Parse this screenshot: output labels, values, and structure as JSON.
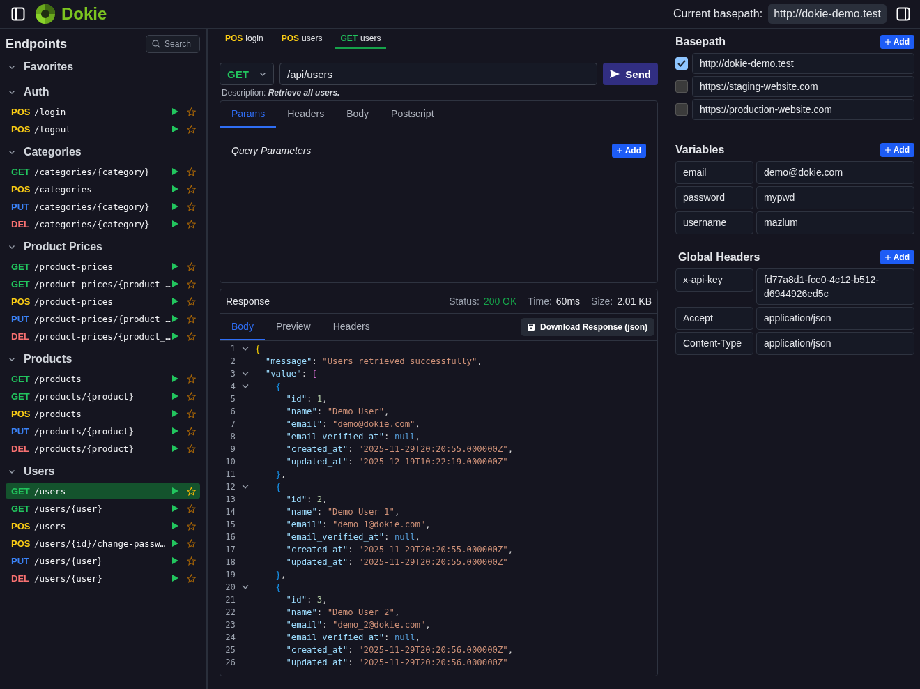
{
  "header": {
    "title": "Dokie",
    "basepath_label": "Current basepath:",
    "basepath": "http://dokie-demo.test"
  },
  "sidebar": {
    "title": "Endpoints",
    "search_placeholder": "Search",
    "groups": [
      {
        "name": "Favorites",
        "expanded": true
      },
      {
        "name": "Auth",
        "expanded": true,
        "endpoints": [
          {
            "method": "POS",
            "color": "#facc15",
            "path": "/login",
            "selected": false
          },
          {
            "method": "POS",
            "color": "#facc15",
            "path": "/logout",
            "selected": false
          }
        ]
      },
      {
        "name": "Categories",
        "expanded": true,
        "endpoints": [
          {
            "method": "GET",
            "color": "#22c55e",
            "path": "/categories/{category}",
            "selected": false
          },
          {
            "method": "POS",
            "color": "#facc15",
            "path": "/categories",
            "selected": false
          },
          {
            "method": "PUT",
            "color": "#3b82f6",
            "path": "/categories/{category}",
            "selected": false
          },
          {
            "method": "DEL",
            "color": "#f87171",
            "path": "/categories/{category}",
            "selected": false
          }
        ]
      },
      {
        "name": "Product Prices",
        "expanded": true,
        "endpoints": [
          {
            "method": "GET",
            "color": "#22c55e",
            "path": "/product-prices",
            "selected": false
          },
          {
            "method": "GET",
            "color": "#22c55e",
            "path": "/product-prices/{product_…",
            "selected": false
          },
          {
            "method": "POS",
            "color": "#facc15",
            "path": "/product-prices",
            "selected": false
          },
          {
            "method": "PUT",
            "color": "#3b82f6",
            "path": "/product-prices/{product_…",
            "selected": false
          },
          {
            "method": "DEL",
            "color": "#f87171",
            "path": "/product-prices/{product_…",
            "selected": false
          }
        ]
      },
      {
        "name": "Products",
        "expanded": true,
        "endpoints": [
          {
            "method": "GET",
            "color": "#22c55e",
            "path": "/products",
            "selected": false
          },
          {
            "method": "GET",
            "color": "#22c55e",
            "path": "/products/{product}",
            "selected": false
          },
          {
            "method": "POS",
            "color": "#facc15",
            "path": "/products",
            "selected": false
          },
          {
            "method": "PUT",
            "color": "#3b82f6",
            "path": "/products/{product}",
            "selected": false
          },
          {
            "method": "DEL",
            "color": "#f87171",
            "path": "/products/{product}",
            "selected": false
          }
        ]
      },
      {
        "name": "Users",
        "expanded": true,
        "endpoints": [
          {
            "method": "GET",
            "color": "#22c55e",
            "path": "/users",
            "selected": true
          },
          {
            "method": "GET",
            "color": "#22c55e",
            "path": "/users/{user}",
            "selected": false
          },
          {
            "method": "POS",
            "color": "#facc15",
            "path": "/users",
            "selected": false
          },
          {
            "method": "POS",
            "color": "#facc15",
            "path": "/users/{id}/change-passw…",
            "selected": false
          },
          {
            "method": "PUT",
            "color": "#3b82f6",
            "path": "/users/{user}",
            "selected": false
          },
          {
            "method": "DEL",
            "color": "#f87171",
            "path": "/users/{user}",
            "selected": false
          }
        ]
      }
    ]
  },
  "open_tabs": [
    {
      "method": "POS",
      "color": "#facc15",
      "name": "login",
      "selected": false
    },
    {
      "method": "POS",
      "color": "#facc15",
      "name": "users",
      "selected": false
    },
    {
      "method": "GET",
      "color": "#22c55e",
      "name": "users",
      "selected": true
    }
  ],
  "request": {
    "method": {
      "label": "GET",
      "color": "#22c55e"
    },
    "url": "/api/users",
    "send": "Send",
    "description_label": "Description:",
    "description": "Retrieve all users.",
    "tabs": [
      {
        "label": "Params",
        "selected": true
      },
      {
        "label": "Headers",
        "selected": false
      },
      {
        "label": "Body",
        "selected": false
      },
      {
        "label": "Postscript",
        "selected": false
      }
    ],
    "query_title": "Query Parameters",
    "add": "Add"
  },
  "response": {
    "title": "Response",
    "status_label": "Status:",
    "status": "200 OK",
    "time_label": "Time:",
    "time": "60ms",
    "size_label": "Size:",
    "size": "2.01 KB",
    "tabs": [
      {
        "label": "Body",
        "selected": true
      },
      {
        "label": "Preview",
        "selected": false
      },
      {
        "label": "Headers",
        "selected": false
      }
    ],
    "download": "Download Response (json)",
    "lines": [
      {
        "number": "1",
        "foldable": true,
        "tokens": [
          {
            "kind": "brace1",
            "text": "{"
          }
        ]
      },
      {
        "number": "2",
        "foldable": false,
        "tokens": [
          {
            "kind": "key",
            "text": "  \"message\""
          },
          {
            "kind": "p",
            "text": ": "
          },
          {
            "kind": "str",
            "text": "\"Users retrieved successfully\""
          },
          {
            "kind": "p",
            "text": ","
          }
        ]
      },
      {
        "number": "3",
        "foldable": true,
        "tokens": [
          {
            "kind": "key",
            "text": "  \"value\""
          },
          {
            "kind": "p",
            "text": ": "
          },
          {
            "kind": "bracket",
            "text": "["
          }
        ]
      },
      {
        "number": "4",
        "foldable": true,
        "tokens": [
          {
            "kind": "brace2",
            "text": "    {"
          }
        ]
      },
      {
        "number": "5",
        "foldable": false,
        "tokens": [
          {
            "kind": "key",
            "text": "      \"id\""
          },
          {
            "kind": "p",
            "text": ": "
          },
          {
            "kind": "num",
            "text": "1"
          },
          {
            "kind": "p",
            "text": ","
          }
        ]
      },
      {
        "number": "6",
        "foldable": false,
        "tokens": [
          {
            "kind": "key",
            "text": "      \"name\""
          },
          {
            "kind": "p",
            "text": ": "
          },
          {
            "kind": "str",
            "text": "\"Demo User\""
          },
          {
            "kind": "p",
            "text": ","
          }
        ]
      },
      {
        "number": "7",
        "foldable": false,
        "tokens": [
          {
            "kind": "key",
            "text": "      \"email\""
          },
          {
            "kind": "p",
            "text": ": "
          },
          {
            "kind": "str",
            "text": "\"demo@dokie.com\""
          },
          {
            "kind": "p",
            "text": ","
          }
        ]
      },
      {
        "number": "8",
        "foldable": false,
        "tokens": [
          {
            "kind": "key",
            "text": "      \"email_verified_at\""
          },
          {
            "kind": "p",
            "text": ": "
          },
          {
            "kind": "null",
            "text": "null"
          },
          {
            "kind": "p",
            "text": ","
          }
        ]
      },
      {
        "number": "9",
        "foldable": false,
        "tokens": [
          {
            "kind": "key",
            "text": "      \"created_at\""
          },
          {
            "kind": "p",
            "text": ": "
          },
          {
            "kind": "str",
            "text": "\"2025-11-29T20:20:55.000000Z\""
          },
          {
            "kind": "p",
            "text": ","
          }
        ]
      },
      {
        "number": "10",
        "foldable": false,
        "tokens": [
          {
            "kind": "key",
            "text": "      \"updated_at\""
          },
          {
            "kind": "p",
            "text": ": "
          },
          {
            "kind": "str",
            "text": "\"2025-12-19T10:22:19.000000Z\""
          }
        ]
      },
      {
        "number": "11",
        "foldable": false,
        "tokens": [
          {
            "kind": "brace2",
            "text": "    }"
          },
          {
            "kind": "p",
            "text": ","
          }
        ]
      },
      {
        "number": "12",
        "foldable": true,
        "tokens": [
          {
            "kind": "brace2",
            "text": "    {"
          }
        ]
      },
      {
        "number": "13",
        "foldable": false,
        "tokens": [
          {
            "kind": "key",
            "text": "      \"id\""
          },
          {
            "kind": "p",
            "text": ": "
          },
          {
            "kind": "num",
            "text": "2"
          },
          {
            "kind": "p",
            "text": ","
          }
        ]
      },
      {
        "number": "14",
        "foldable": false,
        "tokens": [
          {
            "kind": "key",
            "text": "      \"name\""
          },
          {
            "kind": "p",
            "text": ": "
          },
          {
            "kind": "str",
            "text": "\"Demo User 1\""
          },
          {
            "kind": "p",
            "text": ","
          }
        ]
      },
      {
        "number": "15",
        "foldable": false,
        "tokens": [
          {
            "kind": "key",
            "text": "      \"email\""
          },
          {
            "kind": "p",
            "text": ": "
          },
          {
            "kind": "str",
            "text": "\"demo_1@dokie.com\""
          },
          {
            "kind": "p",
            "text": ","
          }
        ]
      },
      {
        "number": "16",
        "foldable": false,
        "tokens": [
          {
            "kind": "key",
            "text": "      \"email_verified_at\""
          },
          {
            "kind": "p",
            "text": ": "
          },
          {
            "kind": "null",
            "text": "null"
          },
          {
            "kind": "p",
            "text": ","
          }
        ]
      },
      {
        "number": "17",
        "foldable": false,
        "tokens": [
          {
            "kind": "key",
            "text": "      \"created_at\""
          },
          {
            "kind": "p",
            "text": ": "
          },
          {
            "kind": "str",
            "text": "\"2025-11-29T20:20:55.000000Z\""
          },
          {
            "kind": "p",
            "text": ","
          }
        ]
      },
      {
        "number": "18",
        "foldable": false,
        "tokens": [
          {
            "kind": "key",
            "text": "      \"updated_at\""
          },
          {
            "kind": "p",
            "text": ": "
          },
          {
            "kind": "str",
            "text": "\"2025-11-29T20:20:55.000000Z\""
          }
        ]
      },
      {
        "number": "19",
        "foldable": false,
        "tokens": [
          {
            "kind": "brace2",
            "text": "    }"
          },
          {
            "kind": "p",
            "text": ","
          }
        ]
      },
      {
        "number": "20",
        "foldable": true,
        "tokens": [
          {
            "kind": "brace2",
            "text": "    {"
          }
        ]
      },
      {
        "number": "21",
        "foldable": false,
        "tokens": [
          {
            "kind": "key",
            "text": "      \"id\""
          },
          {
            "kind": "p",
            "text": ": "
          },
          {
            "kind": "num",
            "text": "3"
          },
          {
            "kind": "p",
            "text": ","
          }
        ]
      },
      {
        "number": "22",
        "foldable": false,
        "tokens": [
          {
            "kind": "key",
            "text": "      \"name\""
          },
          {
            "kind": "p",
            "text": ": "
          },
          {
            "kind": "str",
            "text": "\"Demo User 2\""
          },
          {
            "kind": "p",
            "text": ","
          }
        ]
      },
      {
        "number": "23",
        "foldable": false,
        "tokens": [
          {
            "kind": "key",
            "text": "      \"email\""
          },
          {
            "kind": "p",
            "text": ": "
          },
          {
            "kind": "str",
            "text": "\"demo_2@dokie.com\""
          },
          {
            "kind": "p",
            "text": ","
          }
        ]
      },
      {
        "number": "24",
        "foldable": false,
        "tokens": [
          {
            "kind": "key",
            "text": "      \"email_verified_at\""
          },
          {
            "kind": "p",
            "text": ": "
          },
          {
            "kind": "null",
            "text": "null"
          },
          {
            "kind": "p",
            "text": ","
          }
        ]
      },
      {
        "number": "25",
        "foldable": false,
        "tokens": [
          {
            "kind": "key",
            "text": "      \"created_at\""
          },
          {
            "kind": "p",
            "text": ": "
          },
          {
            "kind": "str",
            "text": "\"2025-11-29T20:20:56.000000Z\""
          },
          {
            "kind": "p",
            "text": ","
          }
        ]
      },
      {
        "number": "26",
        "foldable": false,
        "tokens": [
          {
            "kind": "key",
            "text": "      \"updated_at\""
          },
          {
            "kind": "p",
            "text": ": "
          },
          {
            "kind": "str",
            "text": "\"2025-11-29T20:20:56.000000Z\""
          }
        ]
      }
    ]
  },
  "basepaths": {
    "title": "Basepath",
    "add": "Add",
    "items": [
      {
        "url": "http://dokie-demo.test",
        "checked": true
      },
      {
        "url": "https://staging-website.com",
        "checked": false
      },
      {
        "url": "https://production-website.com",
        "checked": false
      }
    ]
  },
  "variables": {
    "title": "Variables",
    "add": "Add",
    "items": [
      {
        "name": "email",
        "value": "demo@dokie.com"
      },
      {
        "name": "password",
        "value": "mypwd"
      },
      {
        "name": "username",
        "value": "mazlum"
      }
    ]
  },
  "global_headers": {
    "title": "Global Headers",
    "add": "Add",
    "items": [
      {
        "name": "x-api-key",
        "value": "fd77a8d1-fce0-4c12-b512-d6944926ed5c"
      },
      {
        "name": "Accept",
        "value": "application/json"
      },
      {
        "name": "Content-Type",
        "value": "application/json"
      }
    ]
  }
}
